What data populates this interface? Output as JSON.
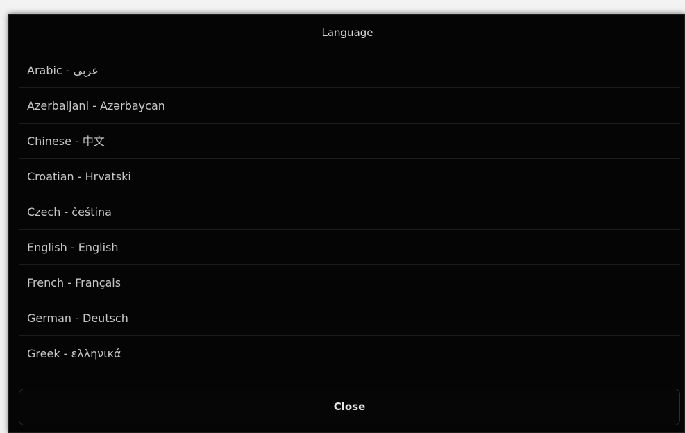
{
  "dialog": {
    "title": "Language",
    "languages": [
      {
        "label": "Arabic - عربى"
      },
      {
        "label": "Azerbaijani - Azərbaycan"
      },
      {
        "label": "Chinese - 中文"
      },
      {
        "label": "Croatian - Hrvatski"
      },
      {
        "label": "Czech - čeština"
      },
      {
        "label": "English - English"
      },
      {
        "label": "French - Français"
      },
      {
        "label": "German - Deutsch"
      },
      {
        "label": "Greek - ελληνικά"
      }
    ],
    "close_label": "Close"
  },
  "colors": {
    "background": "#050505",
    "text": "#c8c8c8",
    "divider": "#1c1c1c",
    "button_border": "#2e2e2e"
  }
}
